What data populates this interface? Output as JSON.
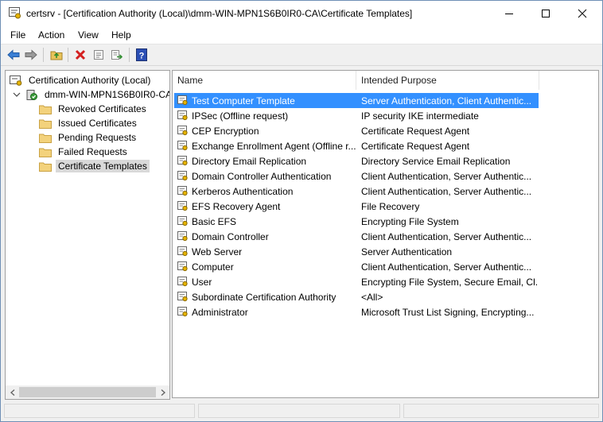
{
  "window": {
    "title": "certsrv - [Certification Authority (Local)\\dmm-WIN-MPN1S6B0IR0-CA\\Certificate Templates]",
    "controls": [
      "minimize-icon",
      "maximize-icon",
      "close-icon"
    ]
  },
  "menu": [
    "File",
    "Action",
    "View",
    "Help"
  ],
  "toolbar": [
    "back-arrow-icon",
    "forward-arrow-icon",
    "up-folder-icon",
    "delete-icon",
    "properties-icon",
    "export-list-icon",
    "help-icon"
  ],
  "tree": {
    "root": "Certification Authority (Local)",
    "ca": "dmm-WIN-MPN1S6B0IR0-CA",
    "items": [
      {
        "label": "Revoked Certificates"
      },
      {
        "label": "Issued Certificates"
      },
      {
        "label": "Pending Requests"
      },
      {
        "label": "Failed Requests"
      },
      {
        "label": "Certificate Templates"
      }
    ],
    "selected": "Certificate Templates"
  },
  "list": {
    "columns": [
      "Name",
      "Intended Purpose"
    ],
    "rows": [
      {
        "name": "Test Computer Template",
        "purpose": "Server Authentication, Client Authentic..."
      },
      {
        "name": "IPSec (Offline request)",
        "purpose": "IP security IKE intermediate"
      },
      {
        "name": "CEP Encryption",
        "purpose": "Certificate Request Agent"
      },
      {
        "name": "Exchange Enrollment Agent (Offline r...",
        "purpose": "Certificate Request Agent"
      },
      {
        "name": "Directory Email Replication",
        "purpose": "Directory Service Email Replication"
      },
      {
        "name": "Domain Controller Authentication",
        "purpose": "Client Authentication, Server Authentic..."
      },
      {
        "name": "Kerberos Authentication",
        "purpose": "Client Authentication, Server Authentic..."
      },
      {
        "name": "EFS Recovery Agent",
        "purpose": "File Recovery"
      },
      {
        "name": "Basic EFS",
        "purpose": "Encrypting File System"
      },
      {
        "name": "Domain Controller",
        "purpose": "Client Authentication, Server Authentic..."
      },
      {
        "name": "Web Server",
        "purpose": "Server Authentication"
      },
      {
        "name": "Computer",
        "purpose": "Client Authentication, Server Authentic..."
      },
      {
        "name": "User",
        "purpose": "Encrypting File System, Secure Email, Cl..."
      },
      {
        "name": "Subordinate Certification Authority",
        "purpose": "<All>"
      },
      {
        "name": "Administrator",
        "purpose": "Microsoft Trust List Signing, Encrypting..."
      }
    ],
    "selected_index": 0
  },
  "colors": {
    "selection": "#3390ff",
    "tree_selection": "#d9d9d9",
    "folder": "#f3d27c",
    "help": "#2b4fb5"
  }
}
